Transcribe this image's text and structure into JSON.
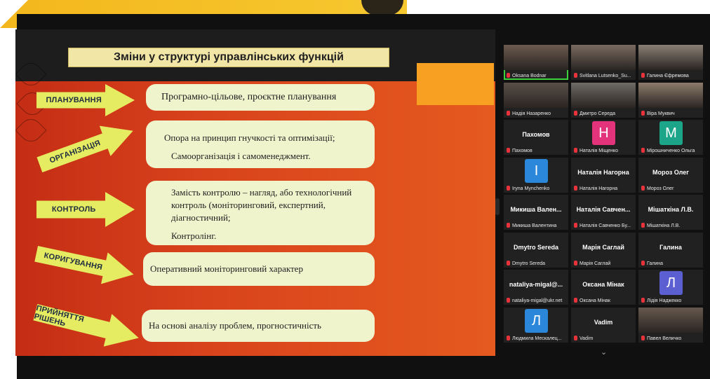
{
  "slide": {
    "title": "Зміни у структурі управлінських функцій",
    "rows": [
      {
        "label": "ПЛАНУВАННЯ",
        "lines": [
          "Програмно-цільове, проєктне планування"
        ]
      },
      {
        "label": "ОРГАНІЗАЦІЯ",
        "lines": [
          "Опора на принцип гнучкості та оптимізації;",
          "Самоорганізація і самоменеджмент."
        ]
      },
      {
        "label": "КОНТРОЛЬ",
        "lines": [
          "Замість контролю – нагляд, або технологічний",
          "контроль (моніторинговий, експертний,",
          "діагностичний;",
          "Контролінг."
        ]
      },
      {
        "label": "КОРИГУВАННЯ",
        "lines": [
          "Оперативний моніторинговий характер"
        ]
      },
      {
        "label": "ПРИЙНЯТТЯ РІШЕНЬ",
        "lines": [
          "На основі аналізу проблем, прогностичність"
        ]
      }
    ]
  },
  "participants": [
    {
      "display": "",
      "caption": "Oksana Bodnar",
      "type": "video",
      "active": true
    },
    {
      "display": "",
      "caption": "Svitlana Lutsenko_Su...",
      "type": "video"
    },
    {
      "display": "",
      "caption": "Галина Єфремова",
      "type": "video"
    },
    {
      "display": "",
      "caption": "Надія Назаренко",
      "type": "video"
    },
    {
      "display": "",
      "caption": "Дмитро Середа",
      "type": "video"
    },
    {
      "display": "",
      "caption": "Віра Муквич",
      "type": "video"
    },
    {
      "display": "Пахомов",
      "caption": "Пахомов",
      "type": "name"
    },
    {
      "display": "Н",
      "caption": "Наталія Міщенко",
      "type": "avatar",
      "color": "#e3337a"
    },
    {
      "display": "М",
      "caption": "Мірошниченко Ольга",
      "type": "avatar",
      "color": "#1da58a"
    },
    {
      "display": "І",
      "caption": "Iryna Mynchenko",
      "type": "avatar",
      "color": "#2b87d9"
    },
    {
      "display": "Наталія Нагорна",
      "caption": "Наталія Нагорна",
      "type": "name"
    },
    {
      "display": "Мороз Олег",
      "caption": "Мороз Олег",
      "type": "name"
    },
    {
      "display": "Микиша Вален...",
      "caption": "Микиша Валентина",
      "type": "name"
    },
    {
      "display": "Наталія Савчен...",
      "caption": "Наталія Савченко Бу...",
      "type": "name"
    },
    {
      "display": "Мішаткіна Л.В.",
      "caption": "Мішаткіна Л.В.",
      "type": "name"
    },
    {
      "display": "Dmytro Sereda",
      "caption": "Dmytro Sereda",
      "type": "name"
    },
    {
      "display": "Марія Саглай",
      "caption": "Марія Саглай",
      "type": "name"
    },
    {
      "display": "Галина",
      "caption": "Галина",
      "type": "name"
    },
    {
      "display": "nataliya-migal@...",
      "caption": "nataliya-migal@ukr.net",
      "type": "name"
    },
    {
      "display": "Оксана Мінак",
      "caption": "Оксана Мінак",
      "type": "name"
    },
    {
      "display": "Л",
      "caption": "Лідія Наджекко",
      "type": "avatar",
      "color": "#5b5fd1"
    },
    {
      "display": "Л",
      "caption": "Людмила Мескалец...",
      "type": "avatar",
      "color": "#2b87d9"
    },
    {
      "display": "Vadim",
      "caption": "Vadim",
      "type": "name"
    },
    {
      "display": "",
      "caption": "Павел Величко",
      "type": "video"
    }
  ],
  "colors": {
    "accent_green": "#3cd23c",
    "mic_muted": "#e8333a",
    "arrow": "#e6ec62",
    "card": "#eff4cd"
  },
  "icons": {
    "scroll": "chevron-down-icon",
    "mic": "mic-muted-icon"
  }
}
